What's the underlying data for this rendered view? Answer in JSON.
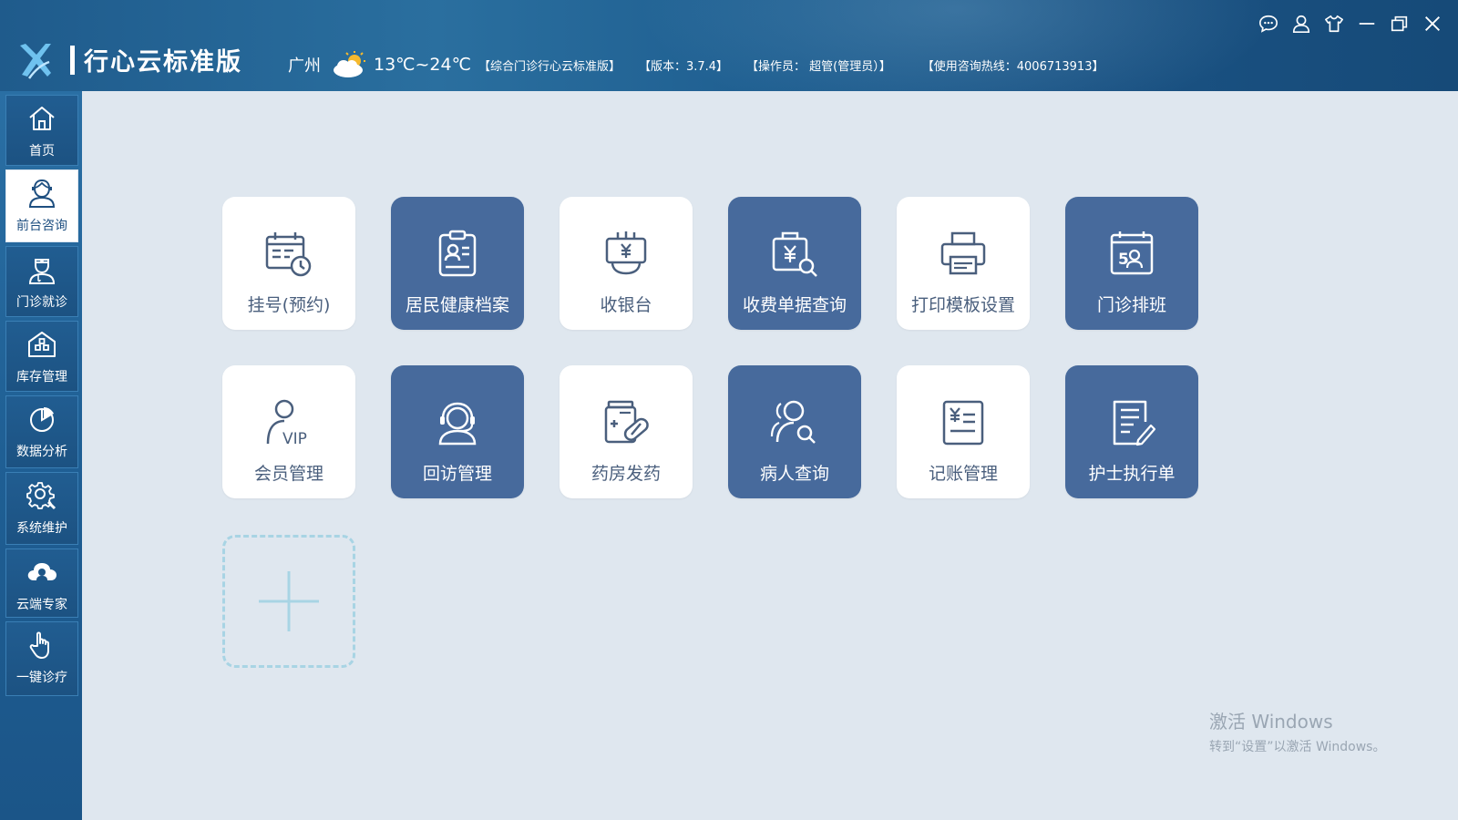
{
  "header": {
    "app_title": "行心云标准版",
    "city": "广州",
    "temperature": "13℃~24℃",
    "edition": "【综合门诊行心云标准版】",
    "version": "【版本：3.7.4】",
    "operator": "【操作员：  超管(管理员）】",
    "hotline": "【使用咨询热线：4006713913】"
  },
  "window_controls": [
    "chat-icon",
    "user-icon",
    "skin-icon",
    "minimize-icon",
    "restore-icon",
    "close-icon"
  ],
  "sidebar": {
    "items": [
      {
        "label": "首页",
        "icon": "home-icon",
        "active": false
      },
      {
        "label": "前台咨询",
        "icon": "receptionist-icon",
        "active": true
      },
      {
        "label": "门诊就诊",
        "icon": "doctor-icon",
        "active": false
      },
      {
        "label": "库存管理",
        "icon": "warehouse-icon",
        "active": false
      },
      {
        "label": "数据分析",
        "icon": "pie-chart-icon",
        "active": false
      },
      {
        "label": "系统维护",
        "icon": "gear-icon",
        "active": false
      },
      {
        "label": "云端专家",
        "icon": "cloud-expert-icon",
        "active": false
      },
      {
        "label": "一键诊疗",
        "icon": "hand-pointer-icon",
        "active": false
      }
    ]
  },
  "tiles": [
    {
      "label": "挂号(预约)",
      "icon": "calendar-clock-icon",
      "style": "light"
    },
    {
      "label": "居民健康档案",
      "icon": "health-record-icon",
      "style": "dark"
    },
    {
      "label": "收银台",
      "icon": "cashier-icon",
      "style": "light"
    },
    {
      "label": "收费单据查询",
      "icon": "bill-search-icon",
      "style": "dark"
    },
    {
      "label": "打印模板设置",
      "icon": "printer-icon",
      "style": "light"
    },
    {
      "label": "门诊排班",
      "icon": "schedule-icon",
      "style": "dark"
    },
    {
      "label": "会员管理",
      "icon": "vip-member-icon",
      "style": "light"
    },
    {
      "label": "回访管理",
      "icon": "headset-icon",
      "style": "dark"
    },
    {
      "label": "药房发药",
      "icon": "pharmacy-icon",
      "style": "light"
    },
    {
      "label": "病人查询",
      "icon": "patient-search-icon",
      "style": "dark"
    },
    {
      "label": "记账管理",
      "icon": "ledger-icon",
      "style": "light"
    },
    {
      "label": "护士执行单",
      "icon": "nurse-order-icon",
      "style": "dark"
    }
  ],
  "colors": {
    "header_bg": "#1e5d8f",
    "sidebar_bg": "#1f5f94",
    "main_bg": "#dfe7ef",
    "tile_dark": "#476a9c",
    "tile_light": "#ffffff",
    "add_tile_border": "#a8d4e4"
  },
  "watermark": {
    "line1": "激活 Windows",
    "line2": "转到“设置”以激活 Windows。"
  }
}
